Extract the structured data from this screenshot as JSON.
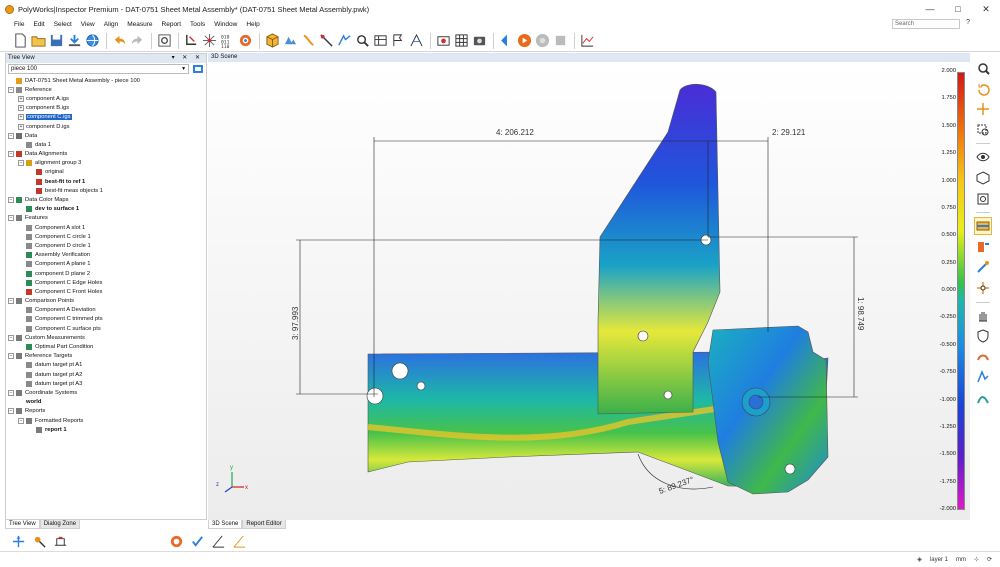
{
  "window": {
    "title": "PolyWorks|Inspector Premium - DAT-0751 Sheet Metal Assembly* (DAT-0751 Sheet Metal Assembly.pwk)",
    "controls": [
      "—",
      "□",
      "✕"
    ]
  },
  "menu": {
    "items": [
      "File",
      "Edit",
      "Select",
      "View",
      "Align",
      "Measure",
      "Report",
      "Tools",
      "Window",
      "Help"
    ],
    "search_placeholder": "Search",
    "help_label": "?"
  },
  "toolbar": {
    "icons": [
      "new-icon",
      "open-icon",
      "save-icon",
      "import-icon",
      "globe-icon",
      "undo-icon",
      "redo-icon",
      "settings-icon",
      "probe-icon",
      "scan-icon",
      "binary-icon",
      "target-icon",
      "cube-icon",
      "align-icon",
      "feature-icon",
      "measure-icon",
      "inspect-icon",
      "report-icon",
      "play-icon",
      "record-icon",
      "chart-icon"
    ]
  },
  "tree_view": {
    "header": "Tree View",
    "header_controls": "▾ ✕ ✕",
    "piece": "piece 100",
    "items": [
      {
        "label": "DAT-0751 Sheet Metal Assembly - piece 100",
        "level": 0,
        "icon": "#e89a1b",
        "exp": "",
        "bold": false,
        "sel": false
      },
      {
        "label": "Reference",
        "level": 0,
        "icon": "#8a8a8a",
        "exp": "−",
        "bold": false,
        "sel": false
      },
      {
        "label": "component A.igs",
        "level": 1,
        "icon": "",
        "exp": "+",
        "bold": false,
        "sel": false
      },
      {
        "label": "component B.igs",
        "level": 1,
        "icon": "",
        "exp": "+",
        "bold": false,
        "sel": false
      },
      {
        "label": "component C.igs",
        "level": 1,
        "icon": "",
        "exp": "+",
        "bold": false,
        "sel": true
      },
      {
        "label": "component D.igs",
        "level": 1,
        "icon": "",
        "exp": "+",
        "bold": false,
        "sel": false
      },
      {
        "label": "Data",
        "level": 0,
        "icon": "#6d6d6d",
        "exp": "−",
        "bold": false,
        "sel": false
      },
      {
        "label": "data 1",
        "level": 1,
        "icon": "#8a8a8a",
        "exp": "",
        "bold": false,
        "sel": false
      },
      {
        "label": "Data Alignments",
        "level": 0,
        "icon": "#c0392b",
        "exp": "−",
        "bold": false,
        "sel": false
      },
      {
        "label": "alignment group 3",
        "level": 1,
        "icon": "#d4a017",
        "exp": "−",
        "bold": false,
        "sel": false
      },
      {
        "label": "original",
        "level": 2,
        "icon": "#c0392b",
        "exp": "",
        "bold": false,
        "sel": false
      },
      {
        "label": "best-fit to ref 1",
        "level": 2,
        "icon": "#c0392b",
        "exp": "",
        "bold": true,
        "sel": false
      },
      {
        "label": "best-fit meas objects 1",
        "level": 2,
        "icon": "#c0392b",
        "exp": "",
        "bold": false,
        "sel": false
      },
      {
        "label": "Data Color Maps",
        "level": 0,
        "icon": "#2e8b57",
        "exp": "−",
        "bold": false,
        "sel": false
      },
      {
        "label": "dev to surface 1",
        "level": 1,
        "icon": "#2e8b57",
        "exp": "",
        "bold": true,
        "sel": false
      },
      {
        "label": "Features",
        "level": 0,
        "icon": "#7a7a7a",
        "exp": "−",
        "bold": false,
        "sel": false
      },
      {
        "label": "Component A slot 1",
        "level": 1,
        "icon": "#8a8a8a",
        "exp": "",
        "bold": false,
        "sel": false
      },
      {
        "label": "Component C circle 1",
        "level": 1,
        "icon": "#8a8a8a",
        "exp": "",
        "bold": false,
        "sel": false
      },
      {
        "label": "Component D circle 1",
        "level": 1,
        "icon": "#8a8a8a",
        "exp": "",
        "bold": false,
        "sel": false
      },
      {
        "label": "Assembly Verification",
        "level": 1,
        "icon": "#2e8b57",
        "exp": "",
        "bold": false,
        "sel": false
      },
      {
        "label": "Component A plane 1",
        "level": 1,
        "icon": "#8a8a8a",
        "exp": "",
        "bold": false,
        "sel": false
      },
      {
        "label": "component D plane 2",
        "level": 1,
        "icon": "#2e8b57",
        "exp": "",
        "bold": false,
        "sel": false
      },
      {
        "label": "Component C Edge Holes",
        "level": 1,
        "icon": "#2e8b57",
        "exp": "",
        "bold": false,
        "sel": false
      },
      {
        "label": "Component C Front Holes",
        "level": 1,
        "icon": "#c0392b",
        "exp": "",
        "bold": false,
        "sel": false
      },
      {
        "label": "Comparison Points",
        "level": 0,
        "icon": "#7a7a7a",
        "exp": "−",
        "bold": false,
        "sel": false
      },
      {
        "label": "Component A Deviation",
        "level": 1,
        "icon": "#8a8a8a",
        "exp": "",
        "bold": false,
        "sel": false
      },
      {
        "label": "Component C trimmed pts",
        "level": 1,
        "icon": "#8a8a8a",
        "exp": "",
        "bold": false,
        "sel": false
      },
      {
        "label": "Component C surface pts",
        "level": 1,
        "icon": "#8a8a8a",
        "exp": "",
        "bold": false,
        "sel": false
      },
      {
        "label": "Custom Measurements",
        "level": 0,
        "icon": "#7a7a7a",
        "exp": "−",
        "bold": false,
        "sel": false
      },
      {
        "label": "Optimal Part Condition",
        "level": 1,
        "icon": "#2e8b57",
        "exp": "",
        "bold": false,
        "sel": false
      },
      {
        "label": "Reference Targets",
        "level": 0,
        "icon": "#7a7a7a",
        "exp": "−",
        "bold": false,
        "sel": false
      },
      {
        "label": "datum target pt A1",
        "level": 1,
        "icon": "#8a8a8a",
        "exp": "",
        "bold": false,
        "sel": false
      },
      {
        "label": "datum target pt A2",
        "level": 1,
        "icon": "#8a8a8a",
        "exp": "",
        "bold": false,
        "sel": false
      },
      {
        "label": "datum target pt A3",
        "level": 1,
        "icon": "#8a8a8a",
        "exp": "",
        "bold": false,
        "sel": false
      },
      {
        "label": "Coordinate Systems",
        "level": 0,
        "icon": "#7a7a7a",
        "exp": "−",
        "bold": false,
        "sel": false
      },
      {
        "label": "world",
        "level": 1,
        "icon": "",
        "exp": "",
        "bold": true,
        "sel": false
      },
      {
        "label": "Reports",
        "level": 0,
        "icon": "#7a7a7a",
        "exp": "−",
        "bold": false,
        "sel": false
      },
      {
        "label": "Formatted Reports",
        "level": 1,
        "icon": "#7a7a7a",
        "exp": "−",
        "bold": false,
        "sel": false
      },
      {
        "label": "report 1",
        "level": 2,
        "icon": "#7a7a7a",
        "exp": "",
        "bold": true,
        "sel": false
      }
    ]
  },
  "left_tabs": [
    "Tree View",
    "Dialog Zone"
  ],
  "scene": {
    "header": "3D Scene",
    "tabs": [
      "3D Scene",
      "Report Editor"
    ],
    "dims": {
      "top_left": "4: 206.212",
      "top_right": "2: 29.121",
      "left_vertical": "3: 97.993",
      "right_vertical": "1: 98.749",
      "angle": "5: 89.237°"
    },
    "axis_labels": {
      "x": "x",
      "y": "y",
      "z": "z"
    }
  },
  "color_scale": {
    "labels": [
      "2.000",
      "1.750",
      "1.500",
      "1.250",
      "1.000",
      "0.750",
      "0.500",
      "0.250",
      "0.000",
      "-0.250",
      "-0.500",
      "-0.750",
      "-1.000",
      "-1.250",
      "-1.500",
      "-1.750",
      "-2.000"
    ]
  },
  "right_tools": [
    "zoom-icon",
    "rotate-icon",
    "pan-icon",
    "zoom-window-icon",
    "eye-icon",
    "cube-view-icon",
    "settings-view-icon",
    "color-map-icon",
    "feature-tool-icon",
    "probe-tool-icon",
    "compass-icon",
    "hand-icon",
    "shield-icon",
    "dimension-icon",
    "measure-tool-icon",
    "report-tool-icon"
  ],
  "status": {
    "layer": "layer 1",
    "units": "mm"
  }
}
